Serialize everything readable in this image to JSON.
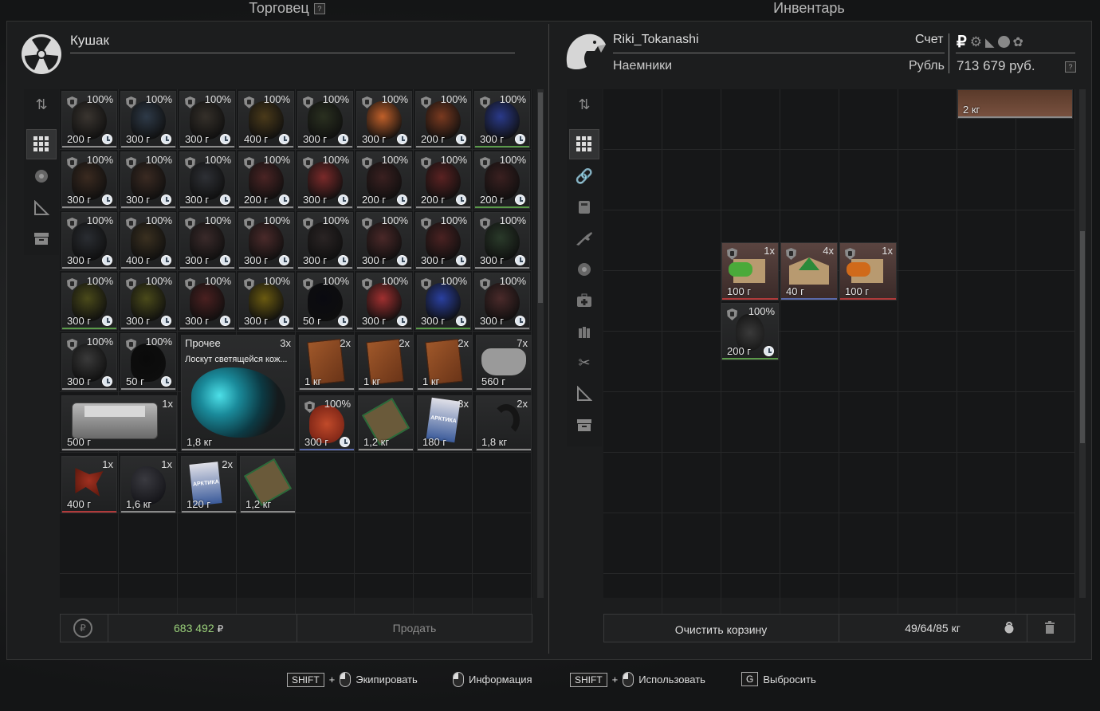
{
  "trader_panel": {
    "title": "Торговец",
    "trader_name": "Кушак",
    "items": [
      {
        "pct": "100%",
        "price": "200 г",
        "color": "#3a3530",
        "bar": "gray"
      },
      {
        "pct": "100%",
        "price": "300 г",
        "color": "#2e3a48",
        "bar": "gray"
      },
      {
        "pct": "100%",
        "price": "300 г",
        "color": "#35302a",
        "bar": "gray"
      },
      {
        "pct": "100%",
        "price": "400 г",
        "color": "#4a3a1a",
        "bar": "gray"
      },
      {
        "pct": "100%",
        "price": "300 г",
        "color": "#2a3020",
        "bar": "gray"
      },
      {
        "pct": "100%",
        "price": "300 г",
        "color": "#c0602a",
        "bar": "gray"
      },
      {
        "pct": "100%",
        "price": "200 г",
        "color": "#7a3a20",
        "bar": "gray"
      },
      {
        "pct": "100%",
        "price": "300 г",
        "color": "#2a3a8a",
        "bar": "green"
      },
      {
        "pct": "100%",
        "price": "300 г",
        "color": "#3a2a20",
        "bar": "gray"
      },
      {
        "pct": "100%",
        "price": "300 г",
        "color": "#3a2a22",
        "bar": "gray"
      },
      {
        "pct": "100%",
        "price": "300 г",
        "color": "#2e3035",
        "bar": "gray"
      },
      {
        "pct": "100%",
        "price": "200 г",
        "color": "#4a2424",
        "bar": "gray"
      },
      {
        "pct": "100%",
        "price": "300 г",
        "color": "#7a2a2a",
        "bar": "gray"
      },
      {
        "pct": "100%",
        "price": "200 г",
        "color": "#3a2020",
        "bar": "gray"
      },
      {
        "pct": "100%",
        "price": "200 г",
        "color": "#5a2222",
        "bar": "gray"
      },
      {
        "pct": "100%",
        "price": "200 г",
        "color": "#3a2020",
        "bar": "green"
      },
      {
        "pct": "100%",
        "price": "300 г",
        "color": "#2a2d32",
        "bar": "gray"
      },
      {
        "pct": "100%",
        "price": "400 г",
        "color": "#3a3020",
        "bar": "gray"
      },
      {
        "pct": "100%",
        "price": "300 г",
        "color": "#3a2a2a",
        "bar": "gray"
      },
      {
        "pct": "100%",
        "price": "300 г",
        "color": "#4a2a2a",
        "bar": "gray"
      },
      {
        "pct": "100%",
        "price": "300 г",
        "color": "#2a2424",
        "bar": "gray"
      },
      {
        "pct": "100%",
        "price": "300 г",
        "color": "#4a2828",
        "bar": "gray"
      },
      {
        "pct": "100%",
        "price": "300 г",
        "color": "#4a2222",
        "bar": "gray"
      },
      {
        "pct": "100%",
        "price": "300 г",
        "color": "#2a3a2a",
        "bar": "gray"
      },
      {
        "pct": "100%",
        "price": "300 г",
        "color": "#4a4a1a",
        "bar": "green"
      },
      {
        "pct": "100%",
        "price": "300 г",
        "color": "#4a4a1a",
        "bar": "gray"
      },
      {
        "pct": "100%",
        "price": "300 г",
        "color": "#4a2020",
        "bar": "gray"
      },
      {
        "pct": "100%",
        "price": "300 г",
        "color": "#6a5a10",
        "bar": "gray"
      },
      {
        "pct": "100%",
        "price": "50 г",
        "color": "#0a0a10",
        "bar": "gray"
      },
      {
        "pct": "100%",
        "price": "300 г",
        "color": "#a03030",
        "bar": "gray"
      },
      {
        "pct": "100%",
        "price": "300 г",
        "color": "#2a40a0",
        "bar": "green"
      },
      {
        "pct": "100%",
        "price": "300 г",
        "color": "#4a2a2a",
        "bar": "gray"
      },
      {
        "pct": "100%",
        "price": "300 г",
        "color": "#3a3a3a",
        "bar": "gray"
      },
      {
        "pct": "100%",
        "price": "50 г",
        "color": "#0a0a0a",
        "bar": "gray"
      }
    ],
    "special_item": {
      "category": "Прочее",
      "count": "3x",
      "name": "Лоскут светящейся кож...",
      "price": "1,8 кг"
    },
    "books": [
      {
        "count": "2x",
        "price": "1 кг"
      },
      {
        "count": "2x",
        "price": "1 кг"
      },
      {
        "count": "2x",
        "price": "1 кг"
      }
    ],
    "controller": {
      "count": "7x",
      "price": "560 г"
    },
    "tin": {
      "count": "1x",
      "price": "500 г"
    },
    "artifact_red": {
      "pct": "100%",
      "price": "300 г"
    },
    "board1": {
      "price": "1,2 кг"
    },
    "cigs1": {
      "count": "3x",
      "price": "180 г",
      "brand": "АРКТИКА"
    },
    "horn": {
      "count": "2x",
      "price": "1,8 кг"
    },
    "red_claw": {
      "count": "1x",
      "price": "400 г"
    },
    "black_orb": {
      "count": "1x",
      "price": "1,6 кг"
    },
    "cigs2": {
      "count": "2x",
      "price": "120 г",
      "brand": "АРКТИКА"
    },
    "board2": {
      "price": "1,2 кг"
    },
    "footer": {
      "money": "683 492",
      "currency": "₽",
      "sell": "Продать"
    }
  },
  "inventory_panel": {
    "title": "Инвентарь",
    "player_name": "Riki_Tokanashi",
    "faction": "Наемники",
    "account_label": "Счет",
    "currency_label": "Рубль",
    "balance": "713 679 руб.",
    "chest_weight": "2 кг",
    "items": [
      {
        "count": "1x",
        "price": "100 г",
        "color": "#3a9a3a"
      },
      {
        "count": "4x",
        "price": "40 г",
        "color": "#2a8a3a"
      },
      {
        "count": "1x",
        "price": "100 г",
        "color": "#d06a1a"
      }
    ],
    "artifact": {
      "pct": "100%",
      "price": "200 г"
    },
    "footer": {
      "clear": "Очистить корзину",
      "weight": "49/64/85 кг"
    }
  },
  "hints": [
    {
      "key": "SHIFT",
      "label": "Экипировать"
    },
    {
      "label": "Информация"
    },
    {
      "key": "SHIFT",
      "label": "Использовать"
    },
    {
      "key": "G",
      "label": "Выбросить"
    }
  ]
}
